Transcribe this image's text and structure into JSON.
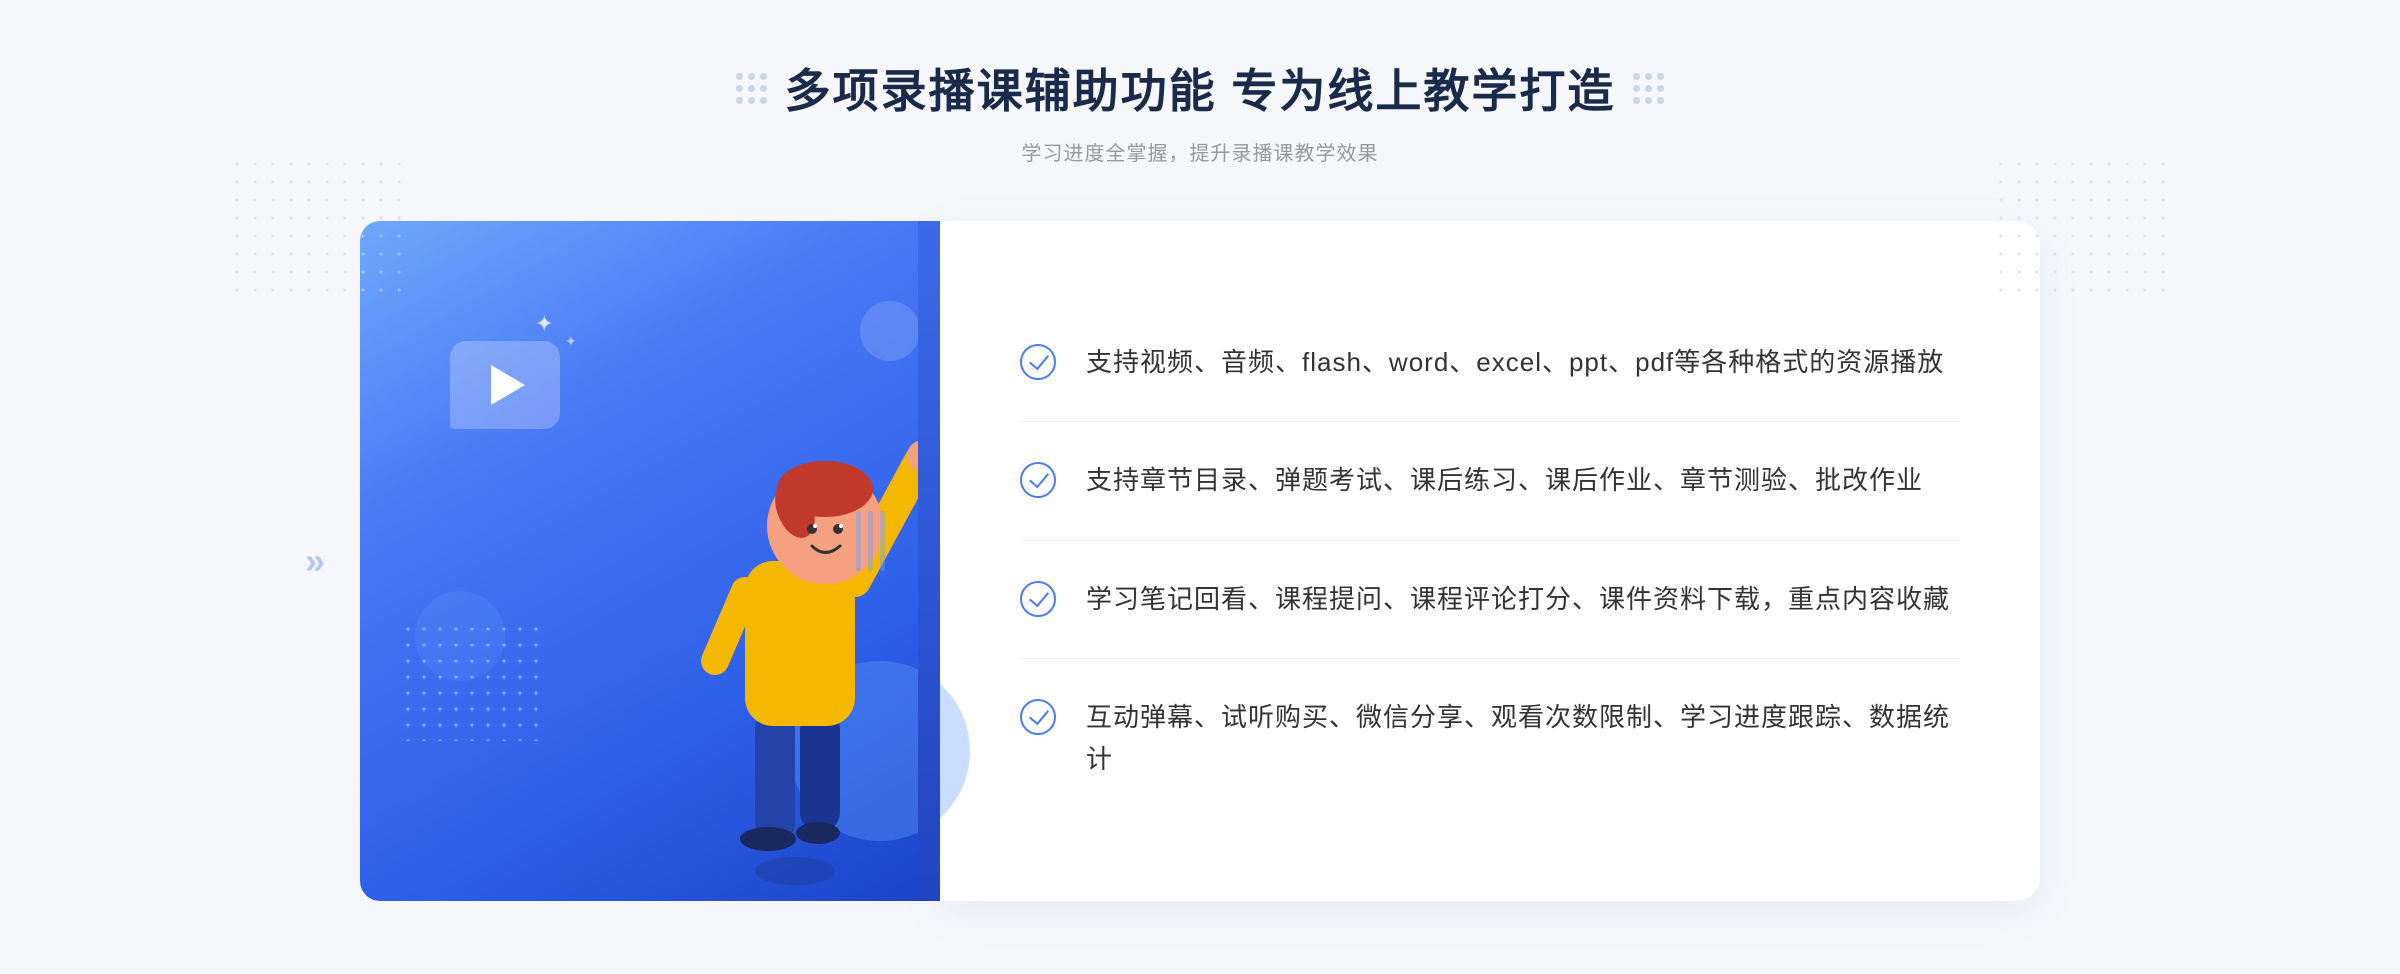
{
  "header": {
    "title": "多项录播课辅助功能 专为线上教学打造",
    "subtitle": "学习进度全掌握，提升录播课教学效果"
  },
  "features": [
    {
      "id": "feature-1",
      "text": "支持视频、音频、flash、word、excel、ppt、pdf等各种格式的资源播放"
    },
    {
      "id": "feature-2",
      "text": "支持章节目录、弹题考试、课后练习、课后作业、章节测验、批改作业"
    },
    {
      "id": "feature-3",
      "text": "学习笔记回看、课程提问、课程评论打分、课件资料下载，重点内容收藏"
    },
    {
      "id": "feature-4",
      "text": "互动弹幕、试听购买、微信分享、观看次数限制、学习进度跟踪、数据统计"
    }
  ]
}
